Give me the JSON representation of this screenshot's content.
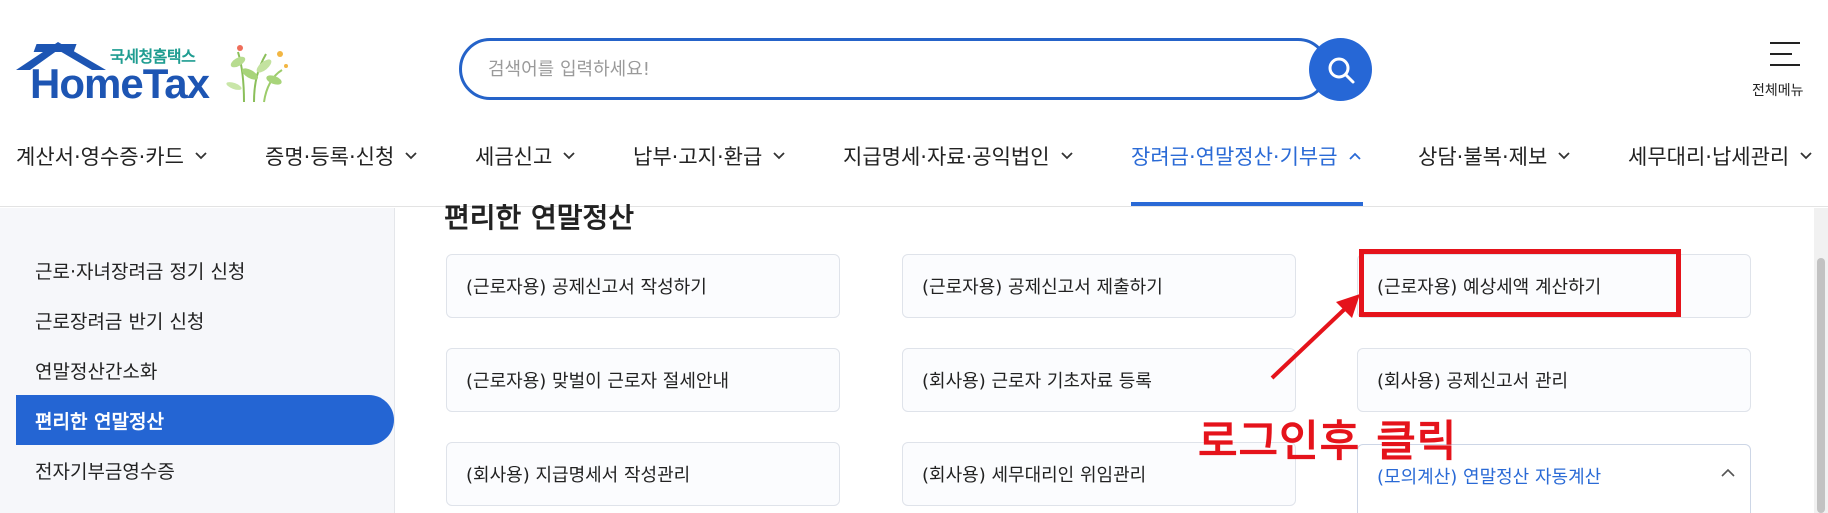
{
  "header": {
    "logo_sub": "국세청홈택스",
    "logo_main": "HomeTax",
    "search_placeholder": "검색어를 입력하세요!",
    "all_menu_label": "전체메뉴"
  },
  "nav": {
    "items": [
      {
        "label": "계산서·영수증·카드",
        "active": false
      },
      {
        "label": "증명·등록·신청",
        "active": false
      },
      {
        "label": "세금신고",
        "active": false
      },
      {
        "label": "납부·고지·환급",
        "active": false
      },
      {
        "label": "지급명세·자료·공익법인",
        "active": false
      },
      {
        "label": "장려금·연말정산·기부금",
        "active": true
      },
      {
        "label": "상담·불복·제보",
        "active": false
      },
      {
        "label": "세무대리·납세관리",
        "active": false
      }
    ]
  },
  "sidebar": {
    "items": [
      {
        "label": "근로·자녀장려금 정기 신청",
        "active": false
      },
      {
        "label": "근로장려금 반기 신청",
        "active": false
      },
      {
        "label": "연말정산간소화",
        "active": false
      },
      {
        "label": "편리한 연말정산",
        "active": true
      },
      {
        "label": "전자기부금영수증",
        "active": false
      }
    ]
  },
  "main": {
    "section_title": "편리한 연말정산",
    "cards": [
      "(근로자용) 공제신고서 작성하기",
      "(근로자용) 공제신고서 제출하기",
      "(근로자용) 예상세액 계산하기",
      "(근로자용) 맞벌이 근로자 절세안내",
      "(회사용) 근로자 기초자료 등록",
      "(회사용) 공제신고서 관리",
      "(회사용) 지급명세서 작성관리",
      "(회사용) 세무대리인 위임관리",
      "(모의계산) 연말정산 자동계산"
    ]
  },
  "annotation": {
    "text": "로그인후 클릭",
    "color": "#e5131b"
  },
  "colors": {
    "brand_blue": "#2465d3",
    "logo_teal": "#1f9d91"
  }
}
